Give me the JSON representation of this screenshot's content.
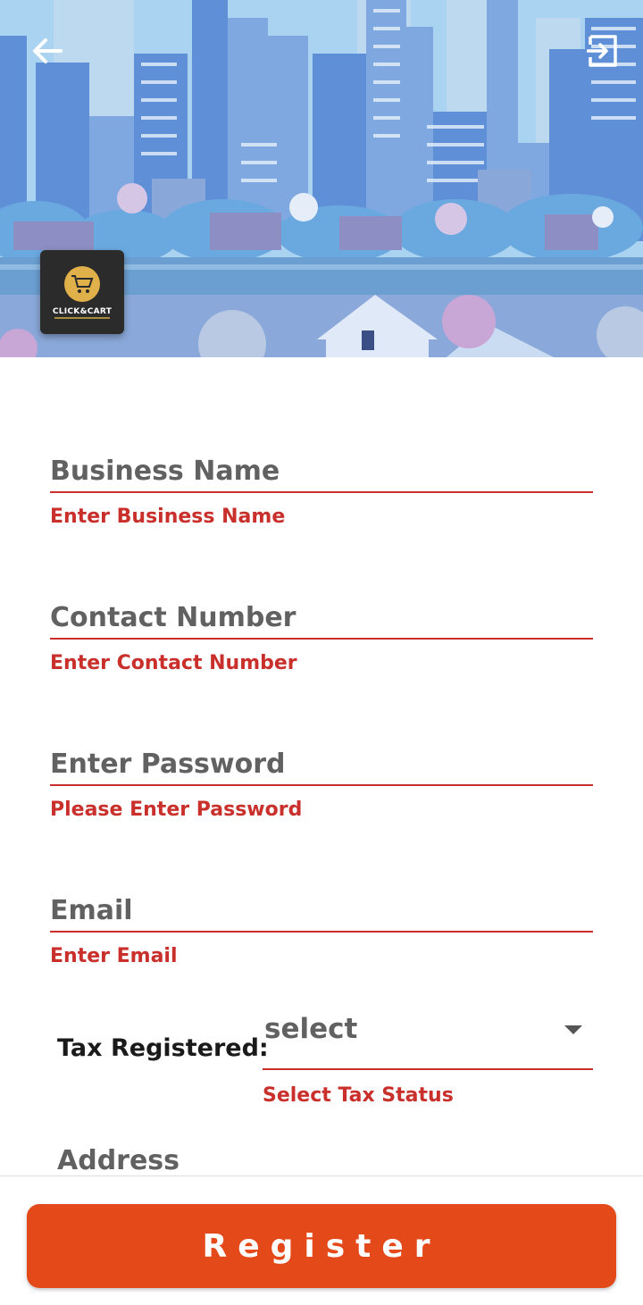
{
  "header": {
    "back_icon": "arrow-left-icon",
    "login_icon": "exit-to-app-icon"
  },
  "logo": {
    "text": "CLICK&CART",
    "icon": "cart-icon",
    "brand_color": "#e0b04a"
  },
  "form": {
    "fields": [
      {
        "placeholder": "Business Name",
        "error": "Enter Business Name"
      },
      {
        "placeholder": "Contact Number",
        "error": "Enter Contact Number"
      },
      {
        "placeholder": "Enter Password",
        "error": "Please Enter Password"
      },
      {
        "placeholder": "Email",
        "error": "Enter Email"
      }
    ],
    "tax": {
      "label": "Tax Registered:",
      "selected": "select",
      "error": "Select Tax Status",
      "icon": "dropdown-caret-icon"
    },
    "address": {
      "placeholder": "Address"
    }
  },
  "actions": {
    "register_label": "Register"
  },
  "colors": {
    "error": "#c9302c",
    "accent": "#e44a19",
    "sky": "#a9d3f0"
  }
}
